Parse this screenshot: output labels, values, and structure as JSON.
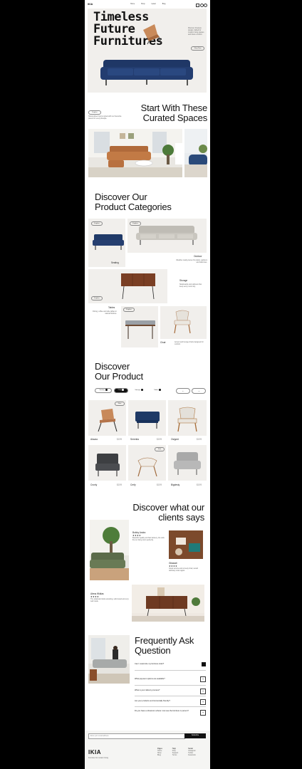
{
  "brand": "IKIA",
  "nav": [
    "Home",
    "Shop",
    "Latest",
    "Blog"
  ],
  "hero": {
    "title_lines": [
      "Timeless",
      "Future",
      "Furnitures"
    ],
    "blurb": "Discover timeless design crafted for modern living spaces and future comfort.",
    "cta": "Shop Now"
  },
  "spaces": {
    "title_lines": [
      "Start With These",
      "Curated Spaces"
    ],
    "tag": "Explore",
    "blurb": "Hand-picked rooms styled with our favourite pieces for every lifestyle."
  },
  "categories": {
    "title_lines": [
      "Discover Our",
      "Product Categories"
    ],
    "items": [
      {
        "name": "Seating",
        "tag": "Explore"
      },
      {
        "name": "Outdoor",
        "tag": "Explore",
        "desc": "Weather-ready pieces for patios, gardens and balconies."
      },
      {
        "name": "Storage",
        "tag": "Explore",
        "desc": "Sideboards and cabinets that keep every room tidy."
      },
      {
        "name": "Tables",
        "tag": "Explore",
        "desc": "Dining, coffee and side tables in natural finishes."
      },
      {
        "name": "Chair",
        "tag": "Explore",
        "desc": "Accent and lounge chairs designed for comfort."
      }
    ]
  },
  "products": {
    "title_lines": [
      "Discover",
      "Our Product"
    ],
    "filters": [
      "Seating",
      "Chair",
      "Storage",
      "Tables"
    ],
    "active_filter": "Chair",
    "items": [
      {
        "name": "Aksara",
        "price": "$199",
        "badge": "New"
      },
      {
        "name": "Serenita",
        "price": "$199",
        "badge": ""
      },
      {
        "name": "Oslgold",
        "price": "$199",
        "badge": ""
      },
      {
        "name": "Cronly",
        "price": "$199",
        "badge": ""
      },
      {
        "name": "Cerfy",
        "price": "$199",
        "badge": "Sale"
      },
      {
        "name": "Bigdesty",
        "price": "$199",
        "badge": ""
      }
    ]
  },
  "testimonials": {
    "title_lines": [
      "Discover what our",
      "clients says"
    ],
    "items": [
      {
        "name": "Bobby Andra",
        "stars": "★★★★",
        "text": "Beautiful quality and fast delivery, the sofa fits our living room perfectly."
      },
      {
        "name": "Gitawati",
        "stars": "★★★★",
        "text": "Great service and a lovely chair, would definitely order again."
      },
      {
        "name": "Alena Widias",
        "stars": "★★★★",
        "text": "The sideboard looks amazing, solid wood and very well made."
      }
    ]
  },
  "faq": {
    "title_lines": [
      "Frequently Ask",
      "Question"
    ],
    "items": [
      "Can I customize my furniture order?",
      "What payment options are available?",
      "What is your delivery process?",
      "Are your products environmentally friendly?",
      "Do you have a showroom where I can see the furniture in person?"
    ]
  },
  "footer": {
    "subscribe_placeholder": "Enter your email address",
    "subscribe_button": "Subscribe",
    "brand": "IKIA",
    "tagline": "Furniture for modern living",
    "columns": [
      {
        "title": "Pages",
        "links": [
          "Home",
          "Shop",
          "Blog"
        ]
      },
      {
        "title": "Help",
        "links": [
          "FAQ",
          "Support",
          "Terms"
        ]
      },
      {
        "title": "Social",
        "links": [
          "Instagram",
          "Twitter",
          "Facebook"
        ]
      }
    ]
  },
  "colors": {
    "navy": "#233a66",
    "wood": "#8b4a2a",
    "ink": "#111111",
    "panel": "#f1efec"
  }
}
